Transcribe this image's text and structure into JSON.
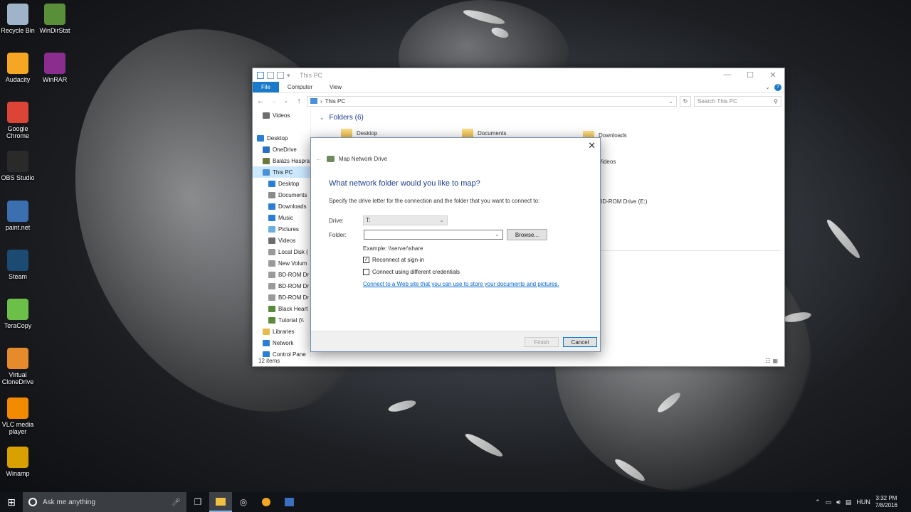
{
  "desktop_icons": [
    {
      "label": "Recycle Bin",
      "icon": "recycle-bin-icon",
      "color": "#9fb4c8"
    },
    {
      "label": "WinDirStat",
      "icon": "windirstat-icon",
      "color": "#5a8f3a"
    },
    {
      "label": "Audacity",
      "icon": "audacity-icon",
      "color": "#f5a623"
    },
    {
      "label": "WinRAR",
      "icon": "winrar-icon",
      "color": "#8a2d8f"
    },
    {
      "label": "Google Chrome",
      "icon": "chrome-icon",
      "color": "#db4437"
    },
    {
      "label": "OBS Studio",
      "icon": "obs-icon",
      "color": "#2a2a2a"
    },
    {
      "label": "paint.net",
      "icon": "paintnet-icon",
      "color": "#3c6fb0"
    },
    {
      "label": "Steam",
      "icon": "steam-icon",
      "color": "#1b4b72"
    },
    {
      "label": "TeraCopy",
      "icon": "teracopy-icon",
      "color": "#6cc04a"
    },
    {
      "label": "Virtual CloneDrive",
      "icon": "clonedrive-icon",
      "color": "#e58b2c"
    },
    {
      "label": "VLC media player",
      "icon": "vlc-icon",
      "color": "#f28a00"
    },
    {
      "label": "Winamp",
      "icon": "winamp-icon",
      "color": "#d8a000"
    }
  ],
  "explorer": {
    "title": "This PC",
    "ribbon_tabs": [
      "File",
      "Computer",
      "View"
    ],
    "address": "This PC",
    "search_placeholder": "Search This PC",
    "nav_items": [
      {
        "label": "Videos",
        "indent": 1,
        "color": "#6d6d6d"
      },
      {
        "label": "",
        "indent": 0,
        "color": "transparent"
      },
      {
        "label": "Desktop",
        "indent": 0,
        "color": "#2a7fd4"
      },
      {
        "label": "OneDrive",
        "indent": 1,
        "color": "#2a6fc4"
      },
      {
        "label": "Balázs Haspra",
        "indent": 1,
        "color": "#6b7a3a"
      },
      {
        "label": "This PC",
        "indent": 1,
        "color": "#4a90d9",
        "selected": true
      },
      {
        "label": "Desktop",
        "indent": 2,
        "color": "#2a7fd4"
      },
      {
        "label": "Documents",
        "indent": 2,
        "color": "#8a8a8a"
      },
      {
        "label": "Downloads",
        "indent": 2,
        "color": "#2a7fd4"
      },
      {
        "label": "Music",
        "indent": 2,
        "color": "#2a7fd4"
      },
      {
        "label": "Pictures",
        "indent": 2,
        "color": "#6ab0e0"
      },
      {
        "label": "Videos",
        "indent": 2,
        "color": "#6d6d6d"
      },
      {
        "label": "Local Disk (",
        "indent": 2,
        "color": "#9a9a9a"
      },
      {
        "label": "New Volum",
        "indent": 2,
        "color": "#9a9a9a"
      },
      {
        "label": "BD-ROM Dr",
        "indent": 2,
        "color": "#9a9a9a"
      },
      {
        "label": "BD-ROM Dr",
        "indent": 2,
        "color": "#9a9a9a"
      },
      {
        "label": "BD-ROM Dr",
        "indent": 2,
        "color": "#9a9a9a"
      },
      {
        "label": "Black Heart",
        "indent": 2,
        "color": "#5a8a3a"
      },
      {
        "label": "Tutorial (\\\\",
        "indent": 2,
        "color": "#5a8a3a"
      },
      {
        "label": "Libraries",
        "indent": 1,
        "color": "#e9b949"
      },
      {
        "label": "Network",
        "indent": 1,
        "color": "#2a7fd4"
      },
      {
        "label": "Control Pane",
        "indent": 1,
        "color": "#2a7fd4"
      }
    ],
    "section_heading": "Folders (6)",
    "folders_visible": [
      "Desktop",
      "Documents",
      "Downloads",
      "Videos"
    ],
    "drives_visible": [
      "BD-ROM Drive (E:)"
    ],
    "status": "12 items"
  },
  "dialog": {
    "title": "Map Network Drive",
    "question": "What network folder would you like to map?",
    "instruction": "Specify the drive letter for the connection and the folder that you want to connect to:",
    "drive_label": "Drive:",
    "drive_value": "T:",
    "folder_label": "Folder:",
    "folder_value": "",
    "browse_label": "Browse...",
    "example": "Example: \\\\server\\share",
    "reconnect_label": "Reconnect at sign-in",
    "reconnect_checked": true,
    "credentials_label": "Connect using different credentials",
    "credentials_checked": false,
    "link_text": "Connect to a Web site that you can use to store your documents and pictures.",
    "finish_label": "Finish",
    "cancel_label": "Cancel"
  },
  "taskbar": {
    "search_placeholder": "Ask me anything",
    "language": "HUN",
    "time": "3:32 PM",
    "date": "7/8/2016"
  }
}
